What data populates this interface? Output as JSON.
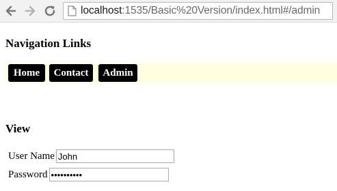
{
  "browser": {
    "url_host": "localhost",
    "url_rest": ":1535/Basic%20Version/index.html#/admin",
    "icons": [
      "back-arrow-icon",
      "forward-arrow-icon",
      "reload-icon",
      "page-icon"
    ]
  },
  "nav": {
    "heading": "Navigation Links",
    "links": [
      {
        "label": "Home"
      },
      {
        "label": "Contact"
      },
      {
        "label": "Admin"
      }
    ],
    "bar_color": "#ffffe0",
    "link_color": "#000000"
  },
  "view": {
    "heading": "View",
    "username_label": "User Name",
    "username_value": "John",
    "password_label": "Password",
    "password_value": "••••••••••"
  }
}
